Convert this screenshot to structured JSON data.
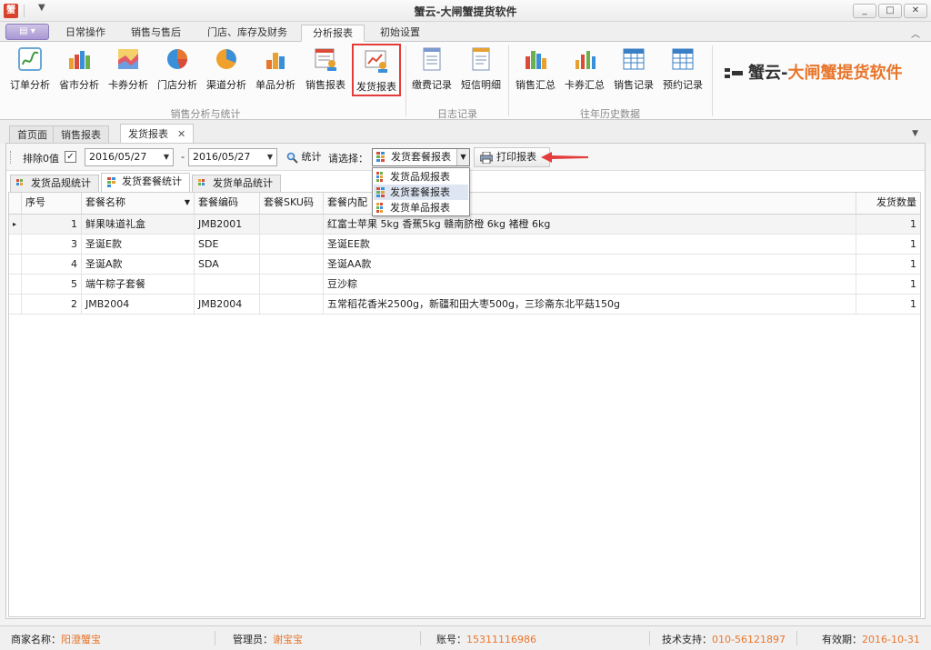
{
  "window": {
    "title": "蟹云-大闸蟹提货软件",
    "controls": [
      "_",
      "□",
      "✕"
    ]
  },
  "ribbon_tabs": [
    "日常操作",
    "销售与售后",
    "门店、库存及财务",
    "分析报表",
    "初始设置"
  ],
  "ribbon_active_tab": "分析报表",
  "ribbon_groups": [
    {
      "label": "销售分析与统计",
      "buttons": [
        "订单分析",
        "省市分析",
        "卡券分析",
        "门店分析",
        "渠道分析",
        "单品分析",
        "销售报表",
        "发货报表"
      ]
    },
    {
      "label": "日志记录",
      "buttons": [
        "缴费记录",
        "短信明细"
      ]
    },
    {
      "label": "往年历史数据",
      "buttons": [
        "销售汇总",
        "卡券汇总",
        "销售记录",
        "预约记录"
      ]
    }
  ],
  "highlighted_button": "发货报表",
  "logo": {
    "part1": "蟹云",
    "dash": "-",
    "part2": "大闸蟹提货软件"
  },
  "doc_tabs": [
    "首页面",
    "销售报表",
    "发货报表"
  ],
  "doc_close": "✕",
  "toolbar": {
    "exclude_zero_label": "排除0值",
    "exclude_zero_checked": "✓",
    "date_from": "2016/05/27",
    "date_sep": "-",
    "date_to": "2016/05/27",
    "stat_label": "统计",
    "choose_label": "请选择：",
    "selected_report": "发货套餐报表",
    "print_label": "打印报表"
  },
  "dropdown_options": [
    "发货品规报表",
    "发货套餐报表",
    "发货单品报表"
  ],
  "dropdown_selected_index": 1,
  "sub_tabs": [
    "发货品规统计",
    "发货套餐统计",
    "发货单品统计"
  ],
  "sub_active": "发货套餐统计",
  "table": {
    "columns": [
      "序号",
      "套餐名称",
      "套餐编码",
      "套餐SKU码",
      "套餐内配",
      "发货数量"
    ],
    "rows": [
      {
        "no": "1",
        "name": "鲜果味道礼盒",
        "code": "JMB2001",
        "sku": "",
        "content": "红富士苹果 5kg  香蕉5kg  赣南脐橙 6kg 褚橙 6kg",
        "qty": "1"
      },
      {
        "no": "3",
        "name": "圣诞E款",
        "code": "SDE",
        "sku": "",
        "content": "圣诞EE款",
        "qty": "1"
      },
      {
        "no": "4",
        "name": "圣诞A款",
        "code": "SDA",
        "sku": "",
        "content": "圣诞AA款",
        "qty": "1"
      },
      {
        "no": "5",
        "name": "端午粽子套餐",
        "code": "",
        "sku": "",
        "content": "豆沙粽",
        "qty": "1"
      },
      {
        "no": "2",
        "name": "JMB2004",
        "code": "JMB2004",
        "sku": "",
        "content": "五常稻花香米2500g，新疆和田大枣500g，三珍斋东北平菇150g",
        "qty": "1"
      }
    ]
  },
  "status": {
    "merchant_label": "商家名称：",
    "merchant": "阳澄蟹宝",
    "admin_label": "管理员：",
    "admin": "谢宝宝",
    "account_label": "账号：",
    "account": "15311116986",
    "support_label": "技术支持：",
    "support": "010-56121897",
    "valid_label": "有效期：",
    "valid": "2016-10-31"
  },
  "colors": {
    "accent": "#e8762c",
    "highlight_border": "#e33c3c"
  }
}
